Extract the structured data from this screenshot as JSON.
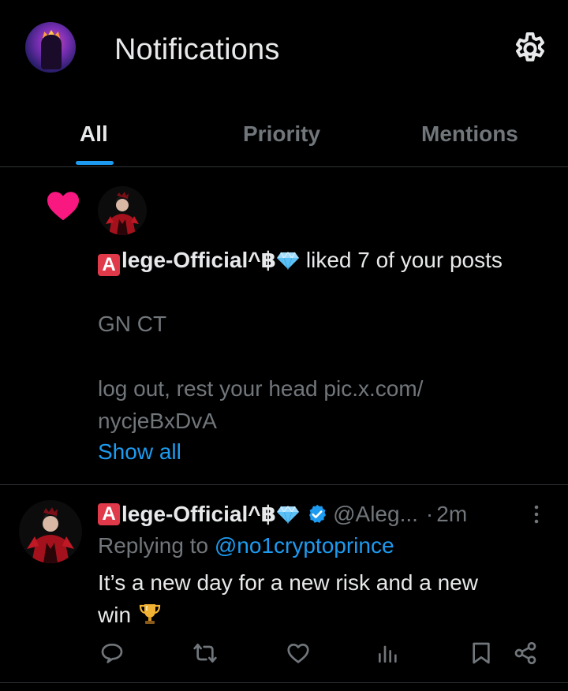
{
  "header": {
    "title": "Notifications",
    "avatar_icon": "profile-avatar",
    "settings_icon": "gear-icon"
  },
  "tabs": [
    {
      "label": "All",
      "active": true
    },
    {
      "label": "Priority",
      "active": false
    },
    {
      "label": "Mentions",
      "active": false
    }
  ],
  "like_notification": {
    "icon": "heart-icon",
    "actor_name": "lege-Official^",
    "actor_badge": "A",
    "actor_symbol": "฿",
    "action_text": " liked 7 of your posts",
    "snippet_line1": "GN CT",
    "snippet_line2": "log out, rest your head pic.x.com/",
    "snippet_line3": "nycjeBxDvA",
    "show_all": "Show all"
  },
  "post": {
    "author_badge": "A",
    "author_name": "lege-Official^",
    "author_symbol": "฿",
    "handle": "@Aleg...",
    "separator": "·",
    "time": "2m",
    "replying_prefix": "Replying to ",
    "replying_to": "@no1cryptoprince",
    "body_line1": "It’s a new day for a new risk and a new",
    "body_line2": "win"
  },
  "colors": {
    "accent": "#1d9bf0",
    "like_pink": "#f91880",
    "muted": "#71767b",
    "divider": "#2f3336"
  }
}
